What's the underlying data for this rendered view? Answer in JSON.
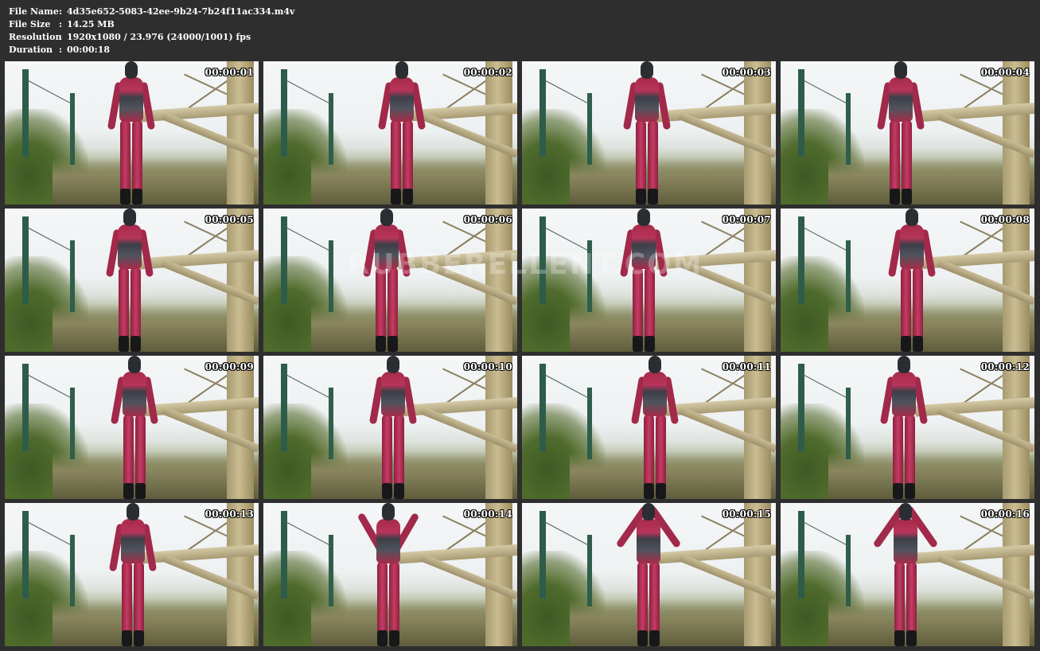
{
  "info": [
    {
      "label": "File Name",
      "value": "4d35e652-5083-42ee-9b24-7b24f11ac334.m4v"
    },
    {
      "label": "File Size",
      "value": "14.25 MB"
    },
    {
      "label": "Resolution",
      "value": "1920x1080 / 23.976 (24000/1001) fps"
    },
    {
      "label": "Duration",
      "value": "00:00:18"
    }
  ],
  "separator": ":",
  "timestamps": [
    "00:00:01",
    "00:00:02",
    "00:00:03",
    "00:00:04",
    "00:00:05",
    "00:00:06",
    "00:00:07",
    "00:00:08",
    "00:00:09",
    "00:00:10",
    "00:00:11",
    "00:00:12",
    "00:00:13",
    "00:00:14",
    "00:00:15",
    "00:00:16"
  ],
  "watermark": "RUBBERELLENT.COM",
  "colors": {
    "background": "#2e2e2e",
    "text": "#ffffff",
    "latex": "#b8345a"
  }
}
